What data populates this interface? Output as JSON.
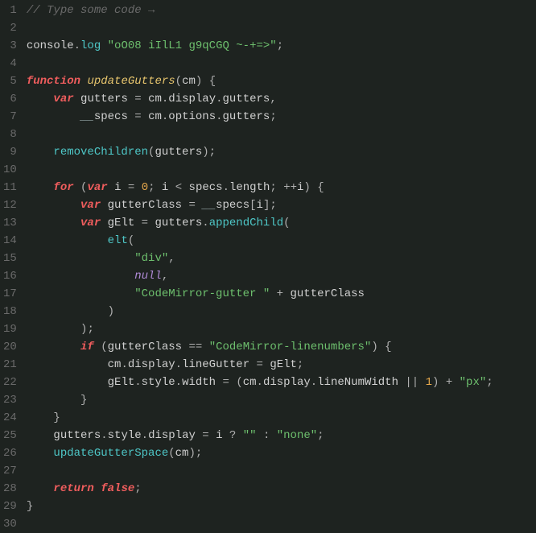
{
  "editor": {
    "line_count": 30,
    "lines": {
      "l1": [
        [
          "cm",
          "// Type some code →"
        ]
      ],
      "l2": [
        [
          "",
          ""
        ]
      ],
      "l3": [
        [
          "var",
          "console"
        ],
        [
          "punc",
          "."
        ],
        [
          "fn",
          "log"
        ],
        [
          "",
          " "
        ],
        [
          "str",
          "\"oO08 iIlL1 g9qCGQ ~-+=>\""
        ],
        [
          "punc",
          ";"
        ]
      ],
      "l4": [
        [
          "",
          ""
        ]
      ],
      "l5": [
        [
          "kw",
          "function"
        ],
        [
          "",
          " "
        ],
        [
          "def",
          "updateGutters"
        ],
        [
          "punc",
          "("
        ],
        [
          "var",
          "cm"
        ],
        [
          "punc",
          ")"
        ],
        [
          "",
          " "
        ],
        [
          "punc",
          "{"
        ]
      ],
      "l6": [
        [
          "",
          "    "
        ],
        [
          "kw",
          "var"
        ],
        [
          "",
          " "
        ],
        [
          "var",
          "gutters"
        ],
        [
          "",
          " "
        ],
        [
          "op",
          "="
        ],
        [
          "",
          " "
        ],
        [
          "var",
          "cm"
        ],
        [
          "punc",
          "."
        ],
        [
          "prop",
          "display"
        ],
        [
          "punc",
          "."
        ],
        [
          "prop",
          "gutters"
        ],
        [
          "punc",
          ","
        ]
      ],
      "l7": [
        [
          "",
          "        "
        ],
        [
          "us",
          "__"
        ],
        [
          "var",
          "specs"
        ],
        [
          "",
          " "
        ],
        [
          "op",
          "="
        ],
        [
          "",
          " "
        ],
        [
          "var",
          "cm"
        ],
        [
          "punc",
          "."
        ],
        [
          "prop",
          "options"
        ],
        [
          "punc",
          "."
        ],
        [
          "prop",
          "gutters"
        ],
        [
          "punc",
          ";"
        ]
      ],
      "l8": [
        [
          "",
          ""
        ]
      ],
      "l9": [
        [
          "",
          "    "
        ],
        [
          "fn",
          "removeChildren"
        ],
        [
          "punc",
          "("
        ],
        [
          "var",
          "gutters"
        ],
        [
          "punc",
          ")"
        ],
        [
          "punc",
          ";"
        ]
      ],
      "l10": [
        [
          "",
          ""
        ]
      ],
      "l11": [
        [
          "",
          "    "
        ],
        [
          "kw",
          "for"
        ],
        [
          "",
          " "
        ],
        [
          "punc",
          "("
        ],
        [
          "kw",
          "var"
        ],
        [
          "",
          " "
        ],
        [
          "var",
          "i"
        ],
        [
          "",
          " "
        ],
        [
          "op",
          "="
        ],
        [
          "",
          " "
        ],
        [
          "num",
          "0"
        ],
        [
          "punc",
          ";"
        ],
        [
          "",
          " "
        ],
        [
          "var",
          "i"
        ],
        [
          "",
          " "
        ],
        [
          "op",
          "<"
        ],
        [
          "",
          " "
        ],
        [
          "var",
          "specs"
        ],
        [
          "punc",
          "."
        ],
        [
          "prop",
          "length"
        ],
        [
          "punc",
          ";"
        ],
        [
          "",
          " "
        ],
        [
          "op",
          "++"
        ],
        [
          "var",
          "i"
        ],
        [
          "punc",
          ")"
        ],
        [
          "",
          " "
        ],
        [
          "punc",
          "{"
        ]
      ],
      "l12": [
        [
          "",
          "        "
        ],
        [
          "kw",
          "var"
        ],
        [
          "",
          " "
        ],
        [
          "var",
          "gutterClass"
        ],
        [
          "",
          " "
        ],
        [
          "op",
          "="
        ],
        [
          "",
          " "
        ],
        [
          "us",
          "__"
        ],
        [
          "var",
          "specs"
        ],
        [
          "punc",
          "["
        ],
        [
          "var",
          "i"
        ],
        [
          "punc",
          "]"
        ],
        [
          "punc",
          ";"
        ]
      ],
      "l13": [
        [
          "",
          "        "
        ],
        [
          "kw",
          "var"
        ],
        [
          "",
          " "
        ],
        [
          "var",
          "gElt"
        ],
        [
          "",
          " "
        ],
        [
          "op",
          "="
        ],
        [
          "",
          " "
        ],
        [
          "var",
          "gutters"
        ],
        [
          "punc",
          "."
        ],
        [
          "fn",
          "appendChild"
        ],
        [
          "punc",
          "("
        ]
      ],
      "l14": [
        [
          "",
          "            "
        ],
        [
          "fn",
          "elt"
        ],
        [
          "punc",
          "("
        ]
      ],
      "l15": [
        [
          "",
          "                "
        ],
        [
          "str",
          "\"div\""
        ],
        [
          "punc",
          ","
        ]
      ],
      "l16": [
        [
          "",
          "                "
        ],
        [
          "null",
          "null"
        ],
        [
          "punc",
          ","
        ]
      ],
      "l17": [
        [
          "",
          "                "
        ],
        [
          "str",
          "\"CodeMirror-gutter \""
        ],
        [
          "",
          " "
        ],
        [
          "op",
          "+"
        ],
        [
          "",
          " "
        ],
        [
          "var",
          "gutterClass"
        ]
      ],
      "l18": [
        [
          "",
          "            "
        ],
        [
          "punc",
          ")"
        ]
      ],
      "l19": [
        [
          "",
          "        "
        ],
        [
          "punc",
          ")"
        ],
        [
          "punc",
          ";"
        ]
      ],
      "l20": [
        [
          "",
          "        "
        ],
        [
          "kw",
          "if"
        ],
        [
          "",
          " "
        ],
        [
          "punc",
          "("
        ],
        [
          "var",
          "gutterClass"
        ],
        [
          "",
          " "
        ],
        [
          "op",
          "=="
        ],
        [
          "",
          " "
        ],
        [
          "str",
          "\"CodeMirror-linenumbers\""
        ],
        [
          "punc",
          ")"
        ],
        [
          "",
          " "
        ],
        [
          "punc",
          "{"
        ]
      ],
      "l21": [
        [
          "",
          "            "
        ],
        [
          "var",
          "cm"
        ],
        [
          "punc",
          "."
        ],
        [
          "prop",
          "display"
        ],
        [
          "punc",
          "."
        ],
        [
          "prop",
          "lineGutter"
        ],
        [
          "",
          " "
        ],
        [
          "op",
          "="
        ],
        [
          "",
          " "
        ],
        [
          "var",
          "gElt"
        ],
        [
          "punc",
          ";"
        ]
      ],
      "l22": [
        [
          "",
          "            "
        ],
        [
          "var",
          "gElt"
        ],
        [
          "punc",
          "."
        ],
        [
          "prop",
          "style"
        ],
        [
          "punc",
          "."
        ],
        [
          "prop",
          "width"
        ],
        [
          "",
          " "
        ],
        [
          "op",
          "="
        ],
        [
          "",
          " "
        ],
        [
          "punc",
          "("
        ],
        [
          "var",
          "cm"
        ],
        [
          "punc",
          "."
        ],
        [
          "prop",
          "display"
        ],
        [
          "punc",
          "."
        ],
        [
          "prop",
          "lineNumWidth"
        ],
        [
          "",
          " "
        ],
        [
          "op",
          "||"
        ],
        [
          "",
          " "
        ],
        [
          "num",
          "1"
        ],
        [
          "punc",
          ")"
        ],
        [
          "",
          " "
        ],
        [
          "op",
          "+"
        ],
        [
          "",
          " "
        ],
        [
          "str",
          "\"px\""
        ],
        [
          "punc",
          ";"
        ]
      ],
      "l23": [
        [
          "",
          "        "
        ],
        [
          "punc",
          "}"
        ]
      ],
      "l24": [
        [
          "",
          "    "
        ],
        [
          "punc",
          "}"
        ]
      ],
      "l25": [
        [
          "",
          "    "
        ],
        [
          "var",
          "gutters"
        ],
        [
          "punc",
          "."
        ],
        [
          "prop",
          "style"
        ],
        [
          "punc",
          "."
        ],
        [
          "prop",
          "display"
        ],
        [
          "",
          " "
        ],
        [
          "op",
          "="
        ],
        [
          "",
          " "
        ],
        [
          "var",
          "i"
        ],
        [
          "",
          " "
        ],
        [
          "op",
          "?"
        ],
        [
          "",
          " "
        ],
        [
          "str",
          "\"\""
        ],
        [
          "",
          " "
        ],
        [
          "op",
          ":"
        ],
        [
          "",
          " "
        ],
        [
          "str",
          "\"none\""
        ],
        [
          "punc",
          ";"
        ]
      ],
      "l26": [
        [
          "",
          "    "
        ],
        [
          "fn",
          "updateGutterSpace"
        ],
        [
          "punc",
          "("
        ],
        [
          "var",
          "cm"
        ],
        [
          "punc",
          ")"
        ],
        [
          "punc",
          ";"
        ]
      ],
      "l27": [
        [
          "",
          ""
        ]
      ],
      "l28": [
        [
          "",
          "    "
        ],
        [
          "kw",
          "return"
        ],
        [
          "",
          " "
        ],
        [
          "kw2",
          "false"
        ],
        [
          "punc",
          ";"
        ]
      ],
      "l29": [
        [
          "punc",
          "}"
        ]
      ],
      "l30": [
        [
          "",
          ""
        ]
      ]
    }
  }
}
